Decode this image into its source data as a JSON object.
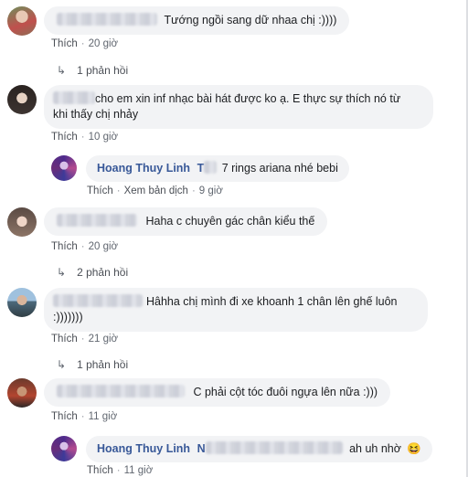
{
  "comments": [
    {
      "text": "Tướng ngồi sang dữ nhaa chị :))))",
      "like": "Thích",
      "time": "20 giờ",
      "replies": "1 phản hồi"
    },
    {
      "text_line1": "cho em xin inf nhạc bài hát được ko ạ. E thực sự thích nó từ",
      "text_line2": "khi thấy chị nhảy",
      "like": "Thích",
      "time": "10 giờ",
      "reply": {
        "author": "Hoang Thuy Linh",
        "author_suffix": "T",
        "text": "7 rings ariana nhé bebi",
        "like": "Thích",
        "translate": "Xem bản dịch",
        "time": "9 giờ"
      }
    },
    {
      "text": "Haha c chuyên gác chân kiểu thế",
      "like": "Thích",
      "time": "20 giờ",
      "replies": "2 phản hồi"
    },
    {
      "text_line1": "Hâhha chị mình đi xe khoanh 1 chân lên ghế luôn",
      "text_line2": ":)))))))",
      "like": "Thích",
      "time": "21 giờ",
      "replies": "1 phản hồi"
    },
    {
      "text": "C phải cột tóc đuôi ngựa lên nữa :)))",
      "like": "Thích",
      "time": "11 giờ",
      "reply": {
        "author": "Hoang Thuy Linh",
        "author_suffix": "N",
        "text": "ah uh nhờ",
        "emoji": "😆",
        "like": "Thích",
        "time": "11 giờ"
      }
    }
  ],
  "colors": {
    "bubble": "#f2f3f5",
    "author": "#385898",
    "meta": "#616770"
  },
  "icons": {
    "reply_arrow": "reply-arrow-icon"
  }
}
